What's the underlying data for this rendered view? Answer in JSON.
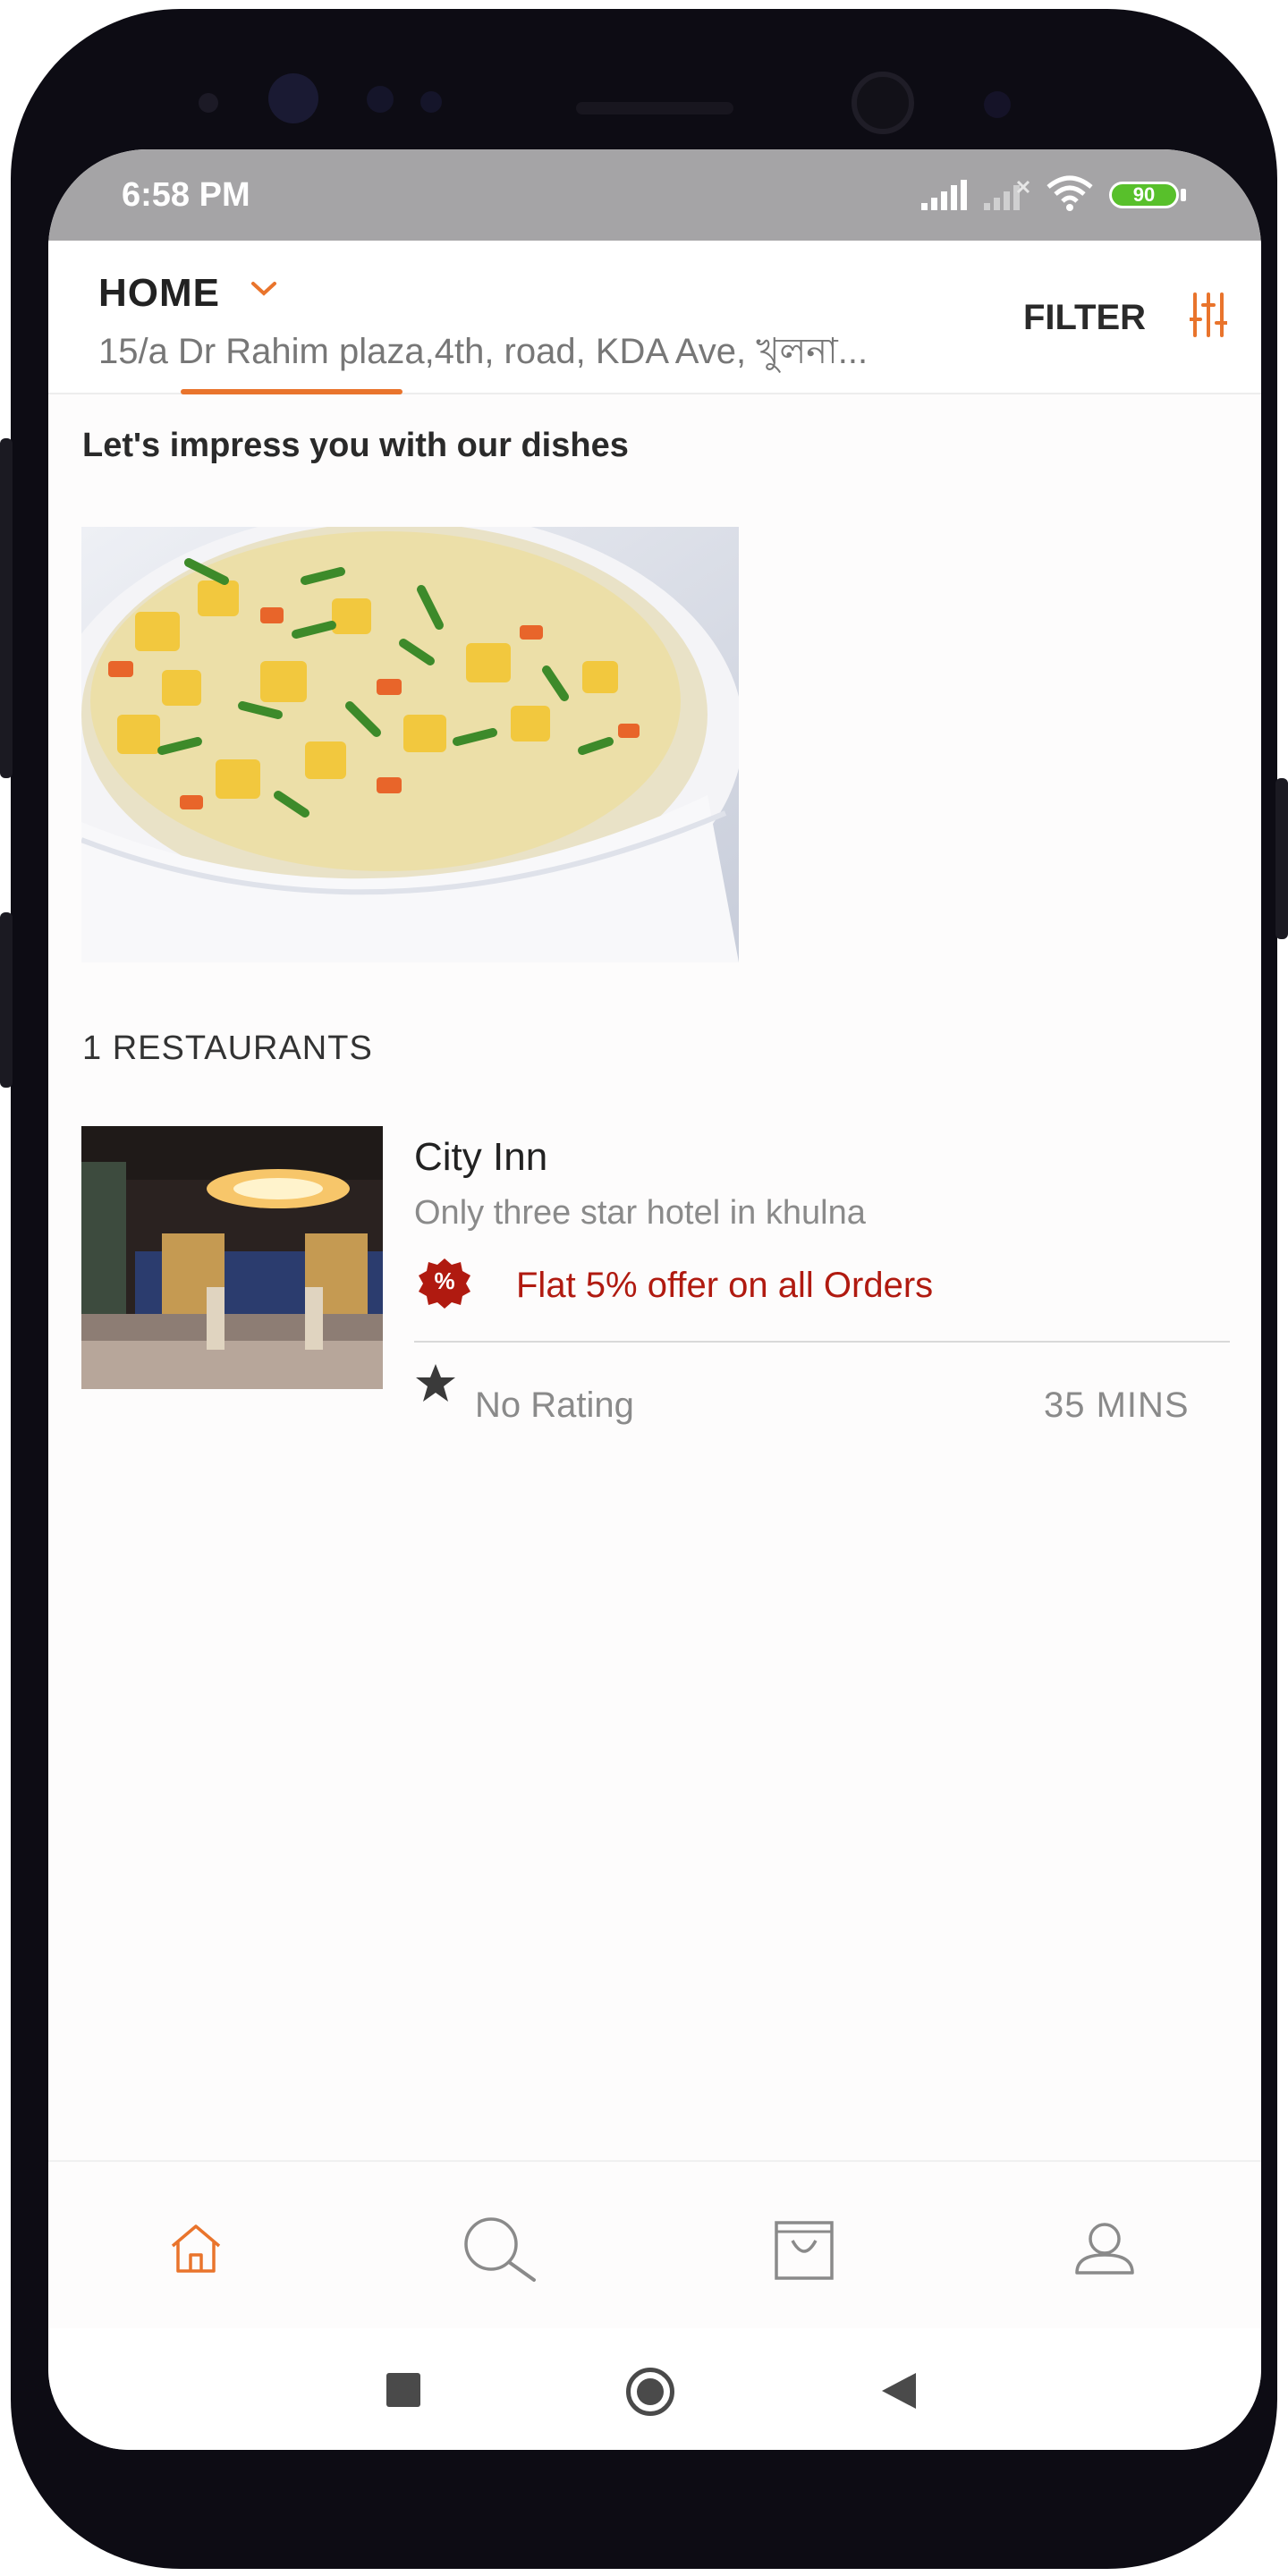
{
  "status_bar": {
    "time": "6:58 PM",
    "battery": "90",
    "icons": [
      "signal-icon",
      "signal-no-service-icon",
      "wifi-icon",
      "battery-icon"
    ]
  },
  "header": {
    "location_label": "HOME",
    "address": "15/a Dr Rahim plaza,4th, road, KDA Ave, খুলনা...",
    "filter_label": "FILTER"
  },
  "section_title": "Let's impress you with our dishes",
  "restaurant_count": "1 RESTAURANTS",
  "restaurants": [
    {
      "name": "City Inn",
      "description": "Only three star hotel in khulna",
      "offer_badge": "%",
      "offer": "Flat 5% offer on all Orders",
      "rating": "No Rating",
      "eta": "35 MINS"
    }
  ],
  "bottom_nav": [
    "home-icon",
    "search-icon",
    "cart-bag-icon",
    "profile-icon"
  ],
  "colors": {
    "accent": "#e9742c",
    "offer": "#b01a10",
    "status_bar": "#a5a4a6"
  }
}
